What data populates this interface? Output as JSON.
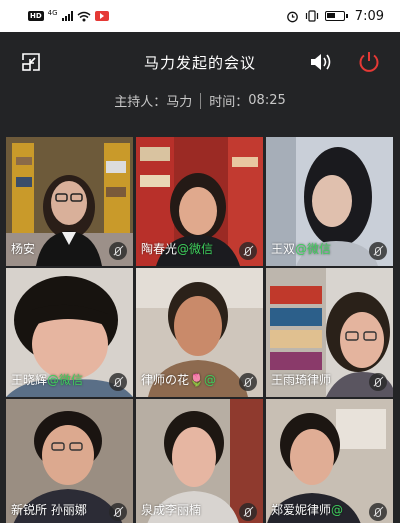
{
  "status_bar": {
    "network_badge": "HD",
    "network_type": "4G",
    "time": "7:09"
  },
  "header": {
    "title": "马力发起的会议",
    "host_label": "主持人：",
    "host_name": "马力",
    "time_label": "时间：",
    "time_value": "08:25"
  },
  "icons": {
    "shrink": "shrink-window-icon",
    "speaker": "speaker-icon",
    "power": "power-icon",
    "mic": "mic-muted-icon"
  },
  "colors": {
    "background": "#232426",
    "wechat_green": "#3ecf5c",
    "power_red": "#e53935"
  },
  "participants": [
    {
      "name": "杨安",
      "suffix": ""
    },
    {
      "name": "陶春光",
      "suffix": "@微信"
    },
    {
      "name": "王双",
      "suffix": "@微信"
    },
    {
      "name": "王晓辉",
      "suffix": "@微信"
    },
    {
      "name": "律师の花🌷",
      "suffix": "@"
    },
    {
      "name": "王雨琦律师",
      "suffix": ""
    },
    {
      "name": "新锐所 孙丽娜",
      "suffix": ""
    },
    {
      "name": "泉成李丽楠",
      "suffix": ""
    },
    {
      "name": "郑爱妮律师",
      "suffix": "@"
    }
  ]
}
